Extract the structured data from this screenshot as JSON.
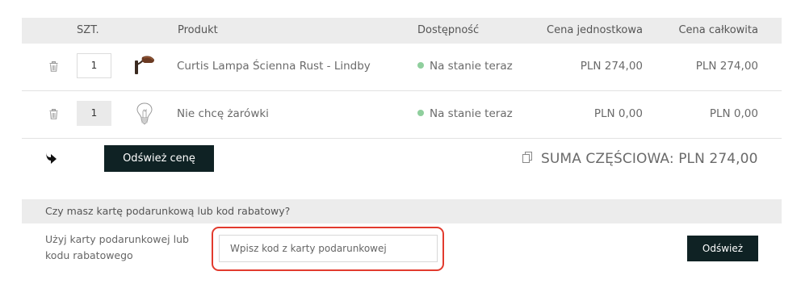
{
  "table": {
    "headers": {
      "qty": "SZT.",
      "product": "Produkt",
      "availability": "Dostępność",
      "unit_price": "Cena jednostkowa",
      "total_price": "Cena całkowita"
    },
    "rows": [
      {
        "qty": "1",
        "name": "Curtis Lampa Ścienna Rust - Lindby",
        "availability": "Na stanie teraz",
        "unit_price": "PLN 274,00",
        "total_price": "PLN 274,00",
        "icon": "wall-lamp"
      },
      {
        "qty": "1",
        "name": "Nie chcę żarówki",
        "availability": "Na stanie teraz",
        "unit_price": "PLN 0,00",
        "total_price": "PLN 0,00",
        "icon": "light-bulb"
      }
    ]
  },
  "actions": {
    "refresh_price_label": "Odśwież cenę",
    "subtotal_text": "SUMA CZĘŚCIOWA: PLN 274,00"
  },
  "gift": {
    "header": "Czy masz kartę podarunkową lub kod rabatowy?",
    "label": "Użyj karty podarunkowej lub kodu rabatowego",
    "placeholder": "Wpisz kod z karty podarunkowej",
    "button_label": "Odśwież"
  },
  "colors": {
    "button_bg": "#0f2224",
    "header_bg": "#ececec",
    "availability_dot": "#8fcf9d",
    "highlight_outline": "#e23b2e"
  }
}
